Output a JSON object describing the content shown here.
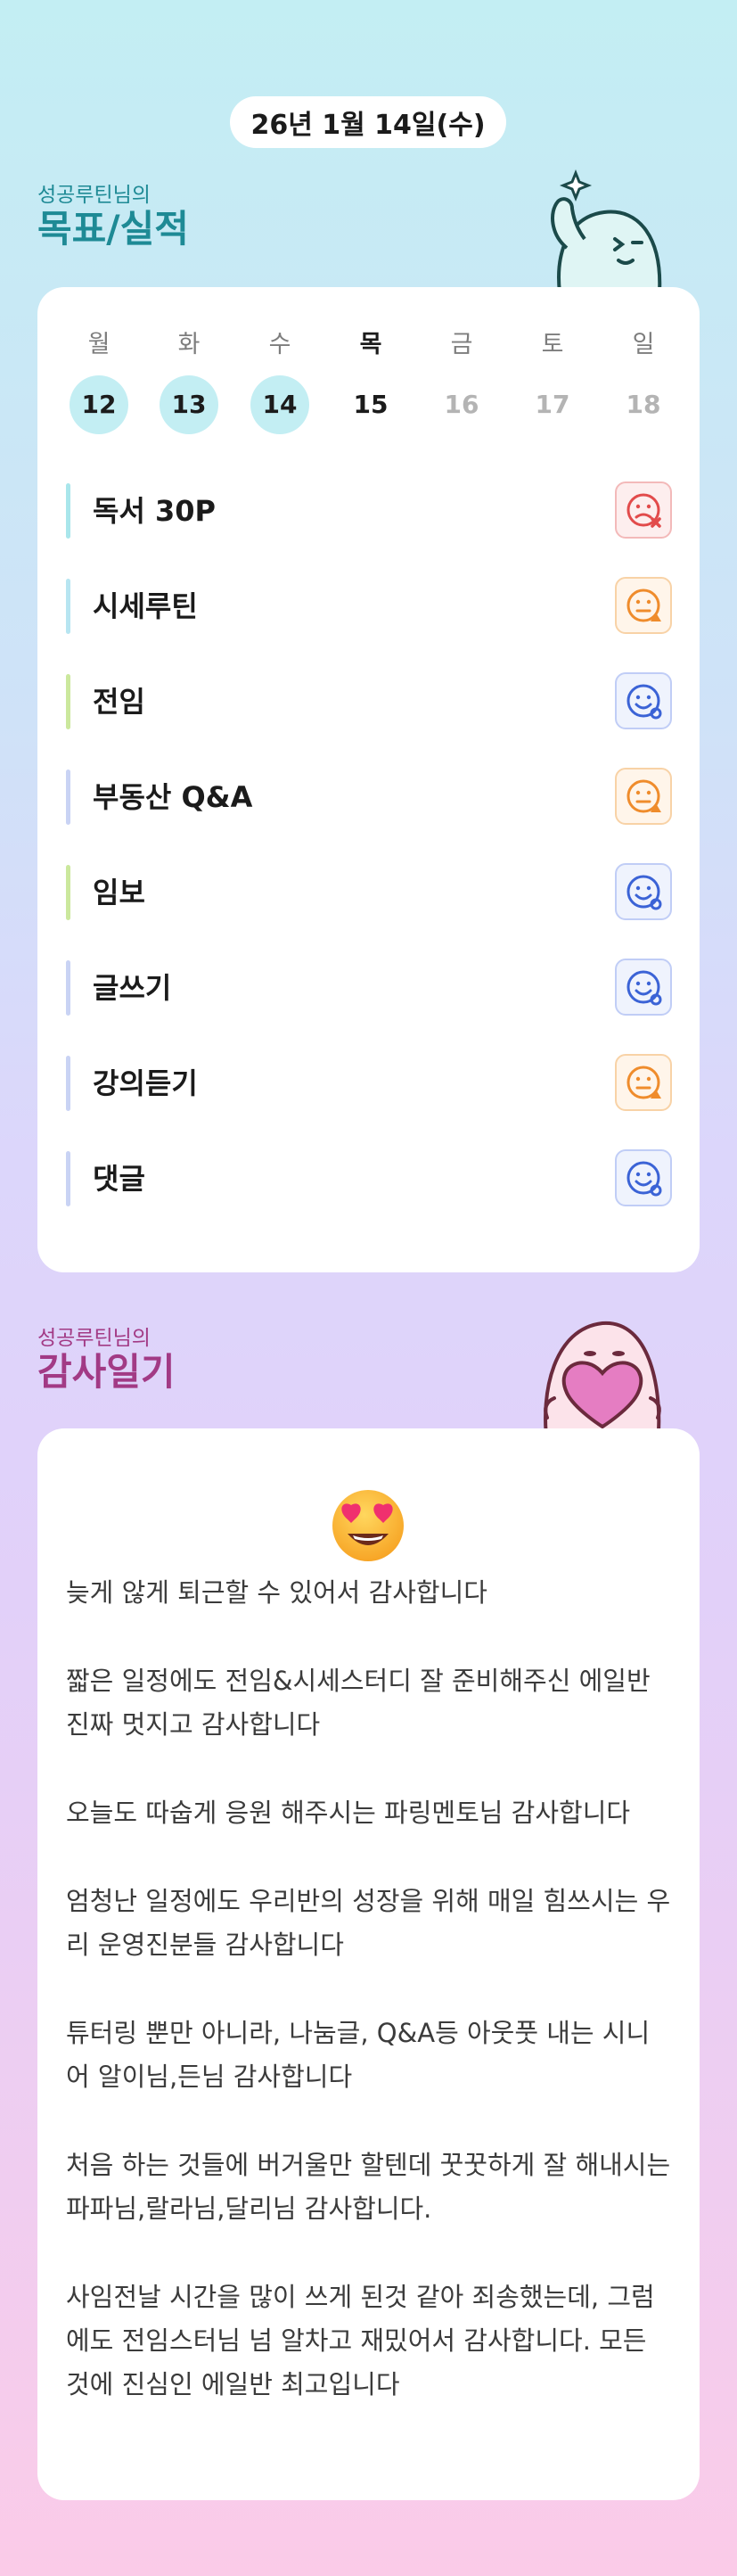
{
  "date": "26년 1월 14일(수)",
  "goals_section": {
    "subtitle": "성공루틴님의",
    "title": "목표/실적"
  },
  "week": [
    {
      "name": "월",
      "num": "12",
      "state": "done"
    },
    {
      "name": "화",
      "num": "13",
      "state": "done"
    },
    {
      "name": "수",
      "num": "14",
      "state": "done"
    },
    {
      "name": "목",
      "num": "15",
      "state": "today"
    },
    {
      "name": "금",
      "num": "16",
      "state": "future"
    },
    {
      "name": "토",
      "num": "17",
      "state": "future"
    },
    {
      "name": "일",
      "num": "18",
      "state": "future"
    }
  ],
  "goals": [
    {
      "label": "독서 30P",
      "status": "fail",
      "bar_color": "#a9e6eb"
    },
    {
      "label": "시세루틴",
      "status": "partial",
      "bar_color": "#b7e5f1"
    },
    {
      "label": "전임",
      "status": "success",
      "bar_color": "#cbe89d"
    },
    {
      "label": "부동산 Q&A",
      "status": "partial",
      "bar_color": "#c9d3f4"
    },
    {
      "label": "임보",
      "status": "success",
      "bar_color": "#cbe89d"
    },
    {
      "label": "글쓰기",
      "status": "success",
      "bar_color": "#c9d3f4"
    },
    {
      "label": "강의듣기",
      "status": "partial",
      "bar_color": "#c9d3f4"
    },
    {
      "label": "댓글",
      "status": "success",
      "bar_color": "#c9d3f4"
    }
  ],
  "gratitude_section": {
    "subtitle": "성공루틴님의",
    "title": "감사일기"
  },
  "gratitude_entries": [
    "늦게 않게 퇴근할 수 있어서 감사합니다",
    "짧은 일정에도 전임&시세스터디 잘 준비해주신 에일반 진짜 멋지고 감사합니다",
    "오늘도 따숩게 응원 해주시는 파링멘토님 감사합니다",
    "엄청난 일정에도 우리반의 성장을 위해 매일 힘쓰시는 우리 운영진분들 감사합니다",
    "튜터링 뿐만 아니라, 나눔글, Q&A등 아웃풋 내는 시니어 알이님,든님 감사합니다",
    "처음 하는 것들에 버거울만 할텐데 꿋꿋하게 잘 해내시는 파파님,랄라님,달리님 감사합니다.",
    "사임전날 시간을 많이 쓰게 된것 같아 죄송했는데, 그럼에도 전임스터님 넘 알차고 재밌어서 감사합니다. 모든 것에 진심인 에일반 최고입니다"
  ],
  "colors": {
    "accent_teal": "#1e8a95",
    "accent_magenta": "#a23a85",
    "done_day": "#c3eef3",
    "status_fail": "#e24b4b",
    "status_partial": "#ef8c2c",
    "status_success": "#3b63d6"
  },
  "icons": {
    "fail": "sad-face-x-icon",
    "partial": "neutral-face-triangle-icon",
    "success": "smile-face-circle-icon",
    "mood": "heart-eyes-emoji-icon"
  }
}
